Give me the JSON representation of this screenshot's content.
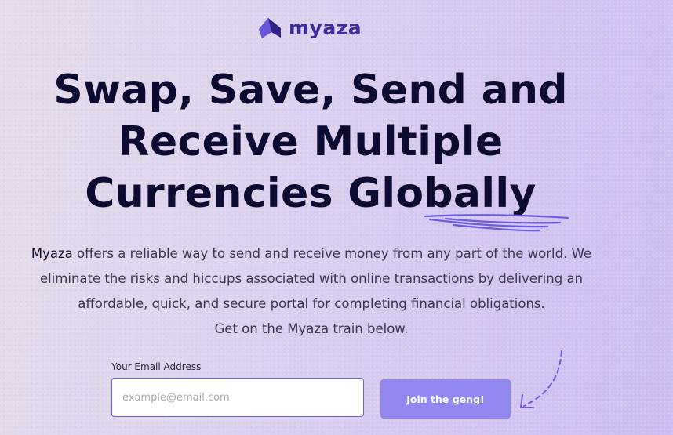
{
  "brand": {
    "name": "myaza",
    "color": "#3d2d9b"
  },
  "hero": {
    "headline_lines": [
      "Swap, Save, Send and",
      "Receive Multiple",
      "Currencies Globally"
    ],
    "description": {
      "brand_word": "Myaza",
      "line1_rest": " offers a reliable way to send and receive money from any part of the world. We",
      "line2": "eliminate the risks and hiccups associated with online transactions by delivering an",
      "line3": "affordable, quick, and secure portal for completing financial obligations.",
      "line4": "Get on the Myaza train below."
    }
  },
  "signup": {
    "email_label": "Your Email Address",
    "email_placeholder": "example@email.com",
    "email_value": "",
    "button_label": "Join the geng!"
  },
  "colors": {
    "headline": "#0e0b33",
    "button": "#9187ef",
    "accent": "#6d5fd6"
  }
}
